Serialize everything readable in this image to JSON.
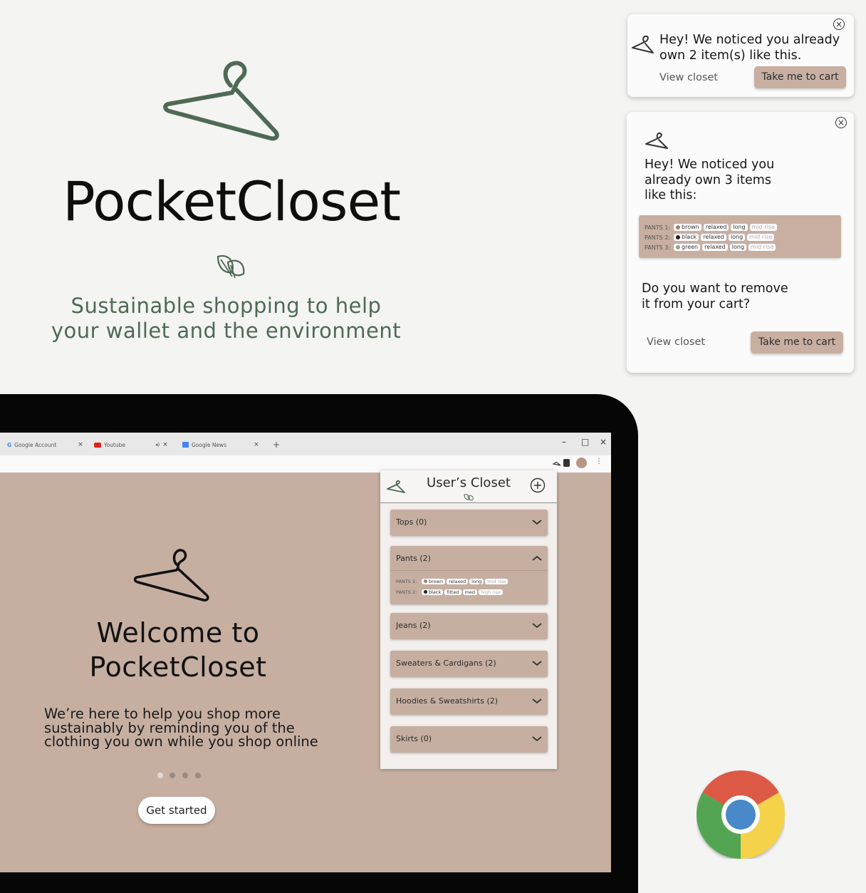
{
  "brand": {
    "title": "PocketCloset",
    "tagline": [
      "Sustainable shopping to help",
      "your wallet and the environment"
    ]
  },
  "popup_small": {
    "message": [
      "Hey! We noticed you already",
      "own 2 item(s) like this."
    ],
    "view_closet": "View closet",
    "cta": "Take me to cart",
    "close": "×"
  },
  "popup_large": {
    "message": [
      "Hey! We noticed you",
      "already own 3 items",
      "like this:"
    ],
    "items": [
      {
        "label": "PANTS 1:",
        "color": "brown",
        "dot": "#9b8474",
        "tags": [
          "relaxed",
          "long"
        ],
        "dim_tag": "mid rise"
      },
      {
        "label": "PANTS 2:",
        "color": "black",
        "dot": "#222222",
        "tags": [
          "relaxed",
          "long"
        ],
        "dim_tag": "mid rise"
      },
      {
        "label": "PANTS 3:",
        "color": "green",
        "dot": "#8fa58f",
        "tags": [
          "relaxed",
          "long"
        ],
        "dim_tag": "mid rise"
      }
    ],
    "question": [
      "Do you want to remove",
      "it from your cart?"
    ],
    "view_closet": "View closet",
    "cta": "Take me to cart",
    "close": "×"
  },
  "browser": {
    "tabs": [
      {
        "title": "Google Account",
        "close": "×"
      },
      {
        "title": "Youtube",
        "close": "×"
      },
      {
        "title": "Google News",
        "close": "×"
      }
    ],
    "new_tab": "+",
    "window_controls": [
      "–",
      "□",
      "×"
    ]
  },
  "welcome": {
    "title": [
      "Welcome to",
      "PocketCloset"
    ],
    "text": [
      "We’re here to help you shop more",
      "sustainably by reminding you of the",
      "clothing you own while you shop online"
    ],
    "button": "Get started",
    "pager": {
      "count": 4,
      "active": 0
    }
  },
  "closet": {
    "title": "User’s Closet",
    "categories": [
      {
        "label": "Tops (0)",
        "expanded": false
      },
      {
        "label": "Pants (2)",
        "expanded": true
      },
      {
        "label": "Jeans (2)",
        "expanded": false
      },
      {
        "label": "Sweaters & Cardigans (2)",
        "expanded": false
      },
      {
        "label": "Hoodies & Sweatshirts (2)",
        "expanded": false
      },
      {
        "label": "Skirts (0)",
        "expanded": false
      }
    ],
    "pants_items": [
      {
        "label": "PANTS 1:",
        "color": "brown",
        "dot": "#9b8474",
        "tags": [
          "relaxed",
          "long"
        ],
        "dim_tag": "mid rise"
      },
      {
        "label": "PANTS 2:",
        "color": "black",
        "dot": "#222222",
        "tags": [
          "fitted",
          "med"
        ],
        "dim_tag": "high rise"
      }
    ]
  },
  "colors": {
    "accent_green": "#4e6a54",
    "tan": "#c6afa1",
    "background": "#f4f4f3"
  }
}
